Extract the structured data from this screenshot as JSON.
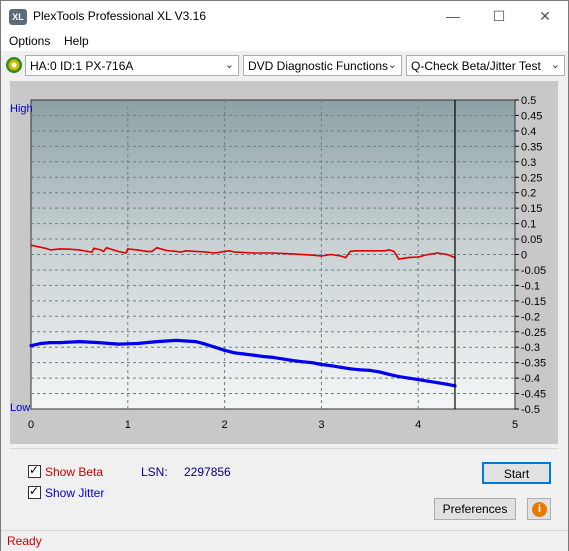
{
  "window": {
    "title": "PlexTools Professional XL V3.16",
    "icon_text": "XL"
  },
  "menu": [
    "Options",
    "Help"
  ],
  "toolbar": {
    "drive": "HA:0 ID:1  PX-716A",
    "function": "DVD Diagnostic Functions",
    "test": "Q-Check Beta/Jitter Test"
  },
  "chart_data": {
    "type": "line",
    "left_axis_labels": {
      "top": "High",
      "bottom": "Low"
    },
    "x": {
      "ticks": [
        "0",
        "1",
        "2",
        "3",
        "4",
        "5"
      ],
      "range": [
        0,
        5
      ]
    },
    "y_right": {
      "ticks": [
        "0.5",
        "0.45",
        "0.4",
        "0.35",
        "0.3",
        "0.25",
        "0.2",
        "0.15",
        "0.1",
        "0.05",
        "0",
        "-0.05",
        "-0.1",
        "-0.15",
        "-0.2",
        "-0.25",
        "-0.3",
        "-0.35",
        "-0.4",
        "-0.45",
        "-0.5"
      ],
      "range": [
        -0.5,
        0.5
      ]
    },
    "cursor_x": 4.38,
    "grid": true,
    "colors": {
      "beta": "#e00000",
      "jitter": "#0000ee",
      "grid": "#6e7f84",
      "cursor": "#000000"
    },
    "series": [
      {
        "name": "Beta",
        "x": [
          0,
          0.08,
          0.15,
          0.2,
          0.3,
          0.4,
          0.5,
          0.58,
          0.63,
          0.65,
          0.72,
          0.75,
          0.78,
          0.85,
          0.9,
          0.98,
          1.0,
          1.1,
          1.2,
          1.25,
          1.3,
          1.4,
          1.5,
          1.55,
          1.6,
          1.7,
          1.8,
          1.9,
          2.0,
          2.05,
          2.1,
          2.3,
          2.5,
          2.7,
          2.9,
          3.0,
          3.1,
          3.2,
          3.25,
          3.3,
          3.35,
          3.5,
          3.65,
          3.7,
          3.75,
          3.8,
          3.9,
          4.0,
          4.1,
          4.2,
          4.3,
          4.38
        ],
        "values": [
          0.03,
          0.025,
          0.02,
          0.015,
          0.018,
          0.017,
          0.015,
          0.01,
          0.008,
          0.02,
          0.015,
          0.01,
          0.022,
          0.015,
          0.01,
          0.005,
          0.018,
          0.015,
          0.01,
          0.01,
          0.022,
          0.013,
          0.01,
          0.008,
          0.012,
          0.01,
          0.008,
          0.005,
          0.01,
          0.012,
          0.008,
          0.005,
          0.005,
          0.002,
          -0.002,
          -0.005,
          0.0,
          -0.005,
          -0.01,
          0.01,
          0.012,
          0.012,
          0.012,
          0.015,
          0.01,
          -0.015,
          -0.01,
          -0.008,
          0.0,
          0.005,
          0.0,
          -0.01
        ]
      },
      {
        "name": "Jitter",
        "x": [
          0,
          0.1,
          0.2,
          0.3,
          0.5,
          0.7,
          0.9,
          1.1,
          1.3,
          1.5,
          1.7,
          1.8,
          1.9,
          2.0,
          2.1,
          2.2,
          2.3,
          2.4,
          2.5,
          2.6,
          2.7,
          2.8,
          2.9,
          3.0,
          3.1,
          3.2,
          3.3,
          3.4,
          3.5,
          3.6,
          3.7,
          3.8,
          3.9,
          4.0,
          4.1,
          4.2,
          4.3,
          4.38
        ],
        "values": [
          -0.295,
          -0.288,
          -0.285,
          -0.285,
          -0.282,
          -0.285,
          -0.29,
          -0.288,
          -0.282,
          -0.278,
          -0.282,
          -0.29,
          -0.3,
          -0.31,
          -0.318,
          -0.322,
          -0.326,
          -0.33,
          -0.333,
          -0.338,
          -0.343,
          -0.347,
          -0.35,
          -0.356,
          -0.36,
          -0.365,
          -0.37,
          -0.373,
          -0.375,
          -0.38,
          -0.388,
          -0.395,
          -0.4,
          -0.405,
          -0.41,
          -0.415,
          -0.42,
          -0.425
        ]
      }
    ]
  },
  "options": {
    "show_beta": "Show Beta",
    "show_jitter": "Show Jitter",
    "lsn_label": "LSN:",
    "lsn_value": "2297856"
  },
  "buttons": {
    "start": "Start",
    "preferences": "Preferences"
  },
  "status": "Ready"
}
